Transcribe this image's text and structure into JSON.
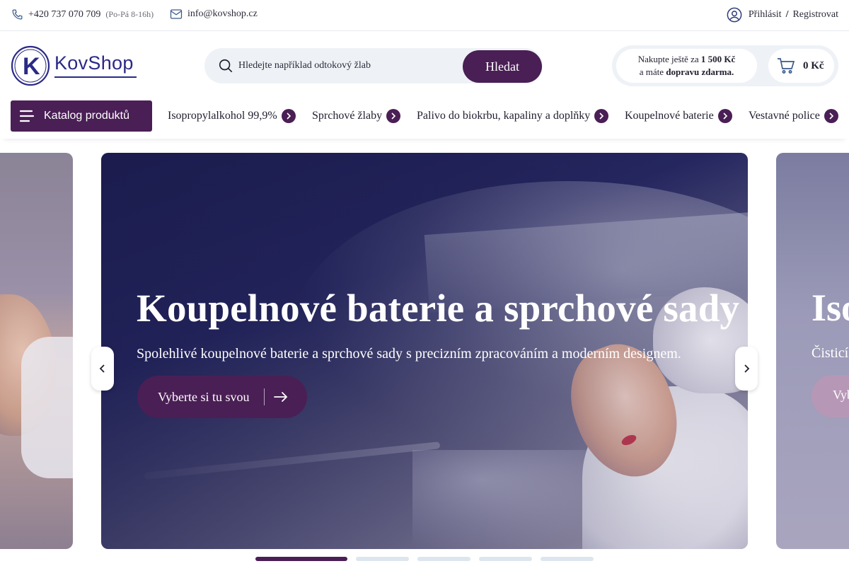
{
  "topbar": {
    "phone": "+420 737 070 709",
    "hours": "(Po-Pá 8-16h)",
    "email": "info@kovshop.cz",
    "login": "Přihlásit",
    "separator": "/",
    "register": "Registrovat"
  },
  "header": {
    "logo_letter": "K",
    "logo_text": "KovShop",
    "search_placeholder": "Hledejte například odtokový žlab",
    "search_button": "Hledat",
    "shipping_line1_prefix": "Nakupte ještě za",
    "shipping_amount": "1 500 Kč",
    "shipping_line2_prefix": "a máte",
    "shipping_free": "dopravu zdarma.",
    "cart_total": "0 Kč"
  },
  "nav": {
    "catalog_label": "Katalog produktů",
    "items": [
      {
        "label": "Isopropylalkohol 99,9%"
      },
      {
        "label": "Sprchové žlaby"
      },
      {
        "label": "Palivo do biokrbu, kapaliny a doplňky"
      },
      {
        "label": "Koupelnové baterie"
      },
      {
        "label": "Vestavné police"
      }
    ]
  },
  "hero": {
    "title": "Koupelnové baterie a sprchové sady",
    "subtitle": "Spolehlivé koupelnové baterie a sprchové sady s precizním zpracováním a moderním designem.",
    "button": "Vyberte si tu svou",
    "next_slide_title": "Isopropylalkohol",
    "next_slide_subtitle": "Čisticí",
    "next_slide_button": "Vyberte",
    "active_slide": 1,
    "slide_count": 5
  },
  "colors": {
    "brand": "#4a1f55",
    "logo": "#2b2a86",
    "search_bg": "#eef2f6",
    "dot_inactive": "#dde6ee"
  },
  "icons": {
    "phone": "phone-icon",
    "email": "mail-icon",
    "user": "user-icon",
    "search": "search-icon",
    "cart": "cart-icon",
    "menu": "menu-icon",
    "chevron": "chevron-right-icon",
    "arrow": "arrow-right-icon"
  }
}
